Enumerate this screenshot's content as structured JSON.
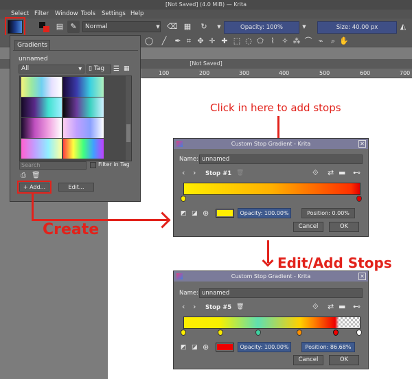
{
  "window": {
    "title": "[Not Saved]  (4.0 MiB)  — Krita"
  },
  "menu": {
    "items": [
      "Select",
      "Filter",
      "Window",
      "Tools",
      "Settings",
      "Help"
    ]
  },
  "toolbar": {
    "blend_mode": "Normal",
    "opacity": "Opacity: 100%",
    "size": "Size: 40.00 px"
  },
  "document": {
    "tab_title": "[Not Saved]",
    "ruler_ticks": [
      "100",
      "200",
      "300",
      "400",
      "500",
      "600",
      "700"
    ]
  },
  "gradients_panel": {
    "tab": "Gradients",
    "current_name": "unnamed",
    "filter_select": "All",
    "tag_button": "Tag",
    "search_placeholder": "Search",
    "filter_in_tag": "Filter in Tag",
    "add_button": "Add...",
    "edit_button": "Edit..."
  },
  "dialog1": {
    "title": "Custom Stop Gradient - Krita",
    "name_label": "Name:",
    "name_value": "unnamed",
    "stop_label": "Stop #1",
    "opacity": "Opacity: 100.00%",
    "position": "Position: 0.00%",
    "stop_color": "#ffee00",
    "cancel": "Cancel",
    "ok": "OK"
  },
  "dialog2": {
    "title": "Custom Stop Gradient - Krita",
    "name_label": "Name:",
    "name_value": "unnamed",
    "stop_label": "Stop #5",
    "opacity": "Opacity: 100.00%",
    "position": "Position: 86.68%",
    "stop_color": "#ee0000",
    "cancel": "Cancel",
    "ok": "OK"
  },
  "annotations": {
    "click_here": "Click in here to add stops",
    "create": "Create",
    "edit_add": "Edit/Add Stops"
  },
  "colors": {
    "annotation_red": "#e2221b",
    "accent_blue": "#3f4f86"
  }
}
